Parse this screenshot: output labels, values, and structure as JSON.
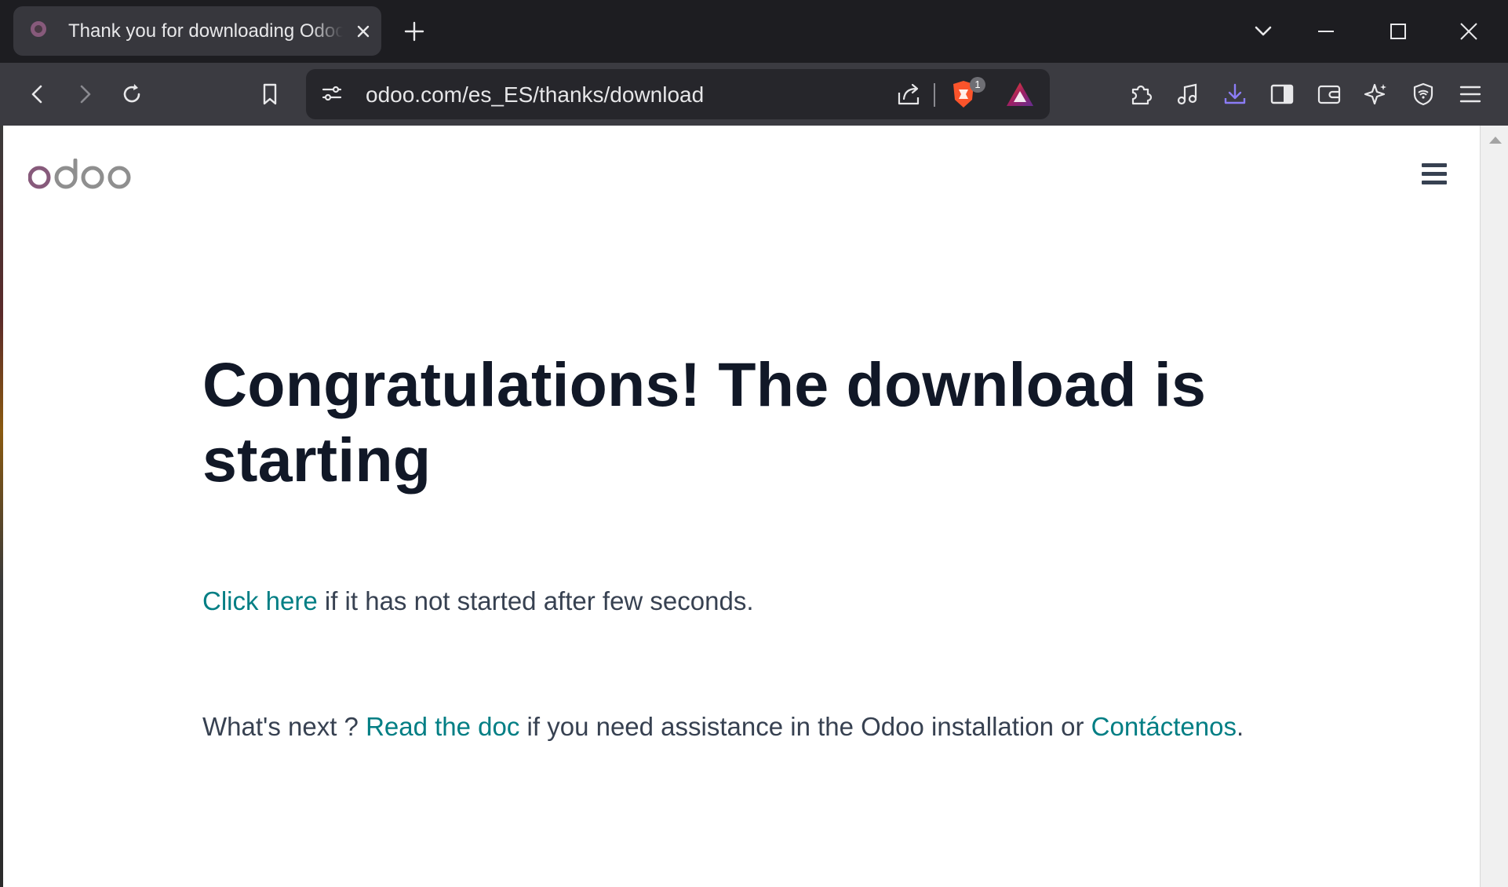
{
  "browser": {
    "tab": {
      "title": "Thank you for downloading Odoo",
      "close_icon": "close-icon",
      "favicon": "odoo-favicon"
    },
    "new_tab_icon": "plus-icon",
    "window_controls": [
      "chevron-down-icon",
      "minimize-icon",
      "maximize-icon",
      "close-icon"
    ],
    "toolbar": {
      "buttons_left": [
        "back-icon",
        "forward-icon",
        "reload-icon",
        "bookmark-icon"
      ],
      "url": "odoo.com/es_ES/thanks/download",
      "shield_badge": "1",
      "buttons_right": [
        "extensions-icon",
        "media-icon",
        "downloads-icon",
        "sidebar-icon",
        "wallet-icon",
        "leo-ai-icon",
        "vpn-icon",
        "menu-icon"
      ]
    },
    "accent_color": "#8b7cf6"
  },
  "page": {
    "logo": "odoo",
    "logo_colors": {
      "o": "#875a7b",
      "doo": "#8f8f8f"
    },
    "headline": "Congratulations! The download is starting",
    "retry": {
      "link": "Click here",
      "text": " if it has not started after few seconds."
    },
    "next": {
      "prefix": "What's next ? ",
      "doc_link": "Read the doc",
      "middle": " if you need assistance in the Odoo installation or ",
      "contact_link": "Contáctenos",
      "suffix": "."
    },
    "link_color": "#017e84",
    "heading_color": "#111827"
  }
}
